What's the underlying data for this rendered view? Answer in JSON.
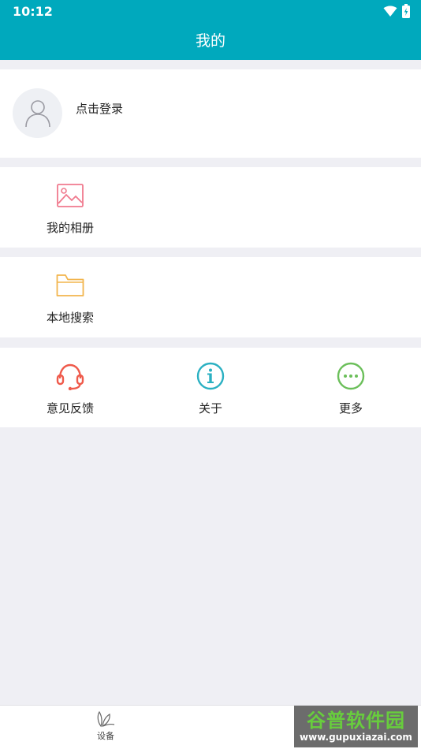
{
  "status": {
    "time": "10:12"
  },
  "header": {
    "title": "我的"
  },
  "profile": {
    "login": "点击登录"
  },
  "menu": {
    "album": "我的相册",
    "local_search": "本地搜索",
    "feedback": "意见反馈",
    "about": "关于",
    "more": "更多"
  },
  "nav": {
    "devices": "设备"
  },
  "watermark": {
    "cn": "谷普软件园",
    "url": "www.gupuxiazai.com"
  },
  "colors": {
    "primary": "#00a9bd",
    "album_icon": "#f07a8e",
    "folder_icon": "#f2b54d",
    "feedback_icon": "#ef5a4b",
    "about_icon": "#2ab0c2",
    "more_icon": "#6bbf5a"
  },
  "icons": {
    "avatar": "person-icon",
    "album": "image-icon",
    "local_search": "folder-icon",
    "feedback": "headset-icon",
    "about": "info-icon",
    "more": "more-dots-icon",
    "devices": "leaf-icon"
  }
}
